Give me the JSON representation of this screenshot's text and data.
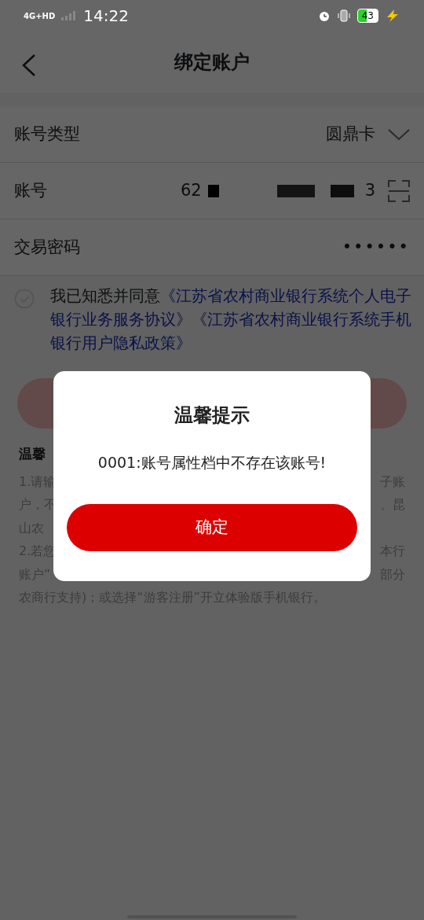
{
  "status_bar": {
    "network": "4G+HD",
    "time": "14:22",
    "battery": "43"
  },
  "header": {
    "title": "绑定账户"
  },
  "form": {
    "rows": [
      {
        "kind": "select",
        "label": "账号类型",
        "value": "圆鼎卡"
      },
      {
        "kind": "account",
        "label": "账号",
        "value_start": "62",
        "value_end": "3"
      },
      {
        "kind": "password",
        "label": "交易密码",
        "value": "••••••"
      }
    ]
  },
  "agreement": {
    "checked": false,
    "text": "我已知悉并同意",
    "links": [
      "《江苏省农村商业银行系统个人电子银行业务服务协议》",
      "《江苏省农村商业银行系统手机银行用户隐私政策》"
    ]
  },
  "tips": {
    "title": "温馨",
    "lines": [
      {
        "left": "1.请输",
        "right": "子账"
      },
      {
        "left": "户，不",
        "right": "、昆"
      },
      {
        "left": "山农"
      },
      {
        "left": "2.若您",
        "right": "本行"
      },
      {
        "left": "账户”",
        "right": "部分"
      },
      {
        "left": "农商行支持)；或选择“游客注册”开立体验版手机银行。"
      }
    ]
  },
  "dialog": {
    "title": "温馨提示",
    "message": "0001:账号属性档中不存在该账号!",
    "button": "确定"
  }
}
